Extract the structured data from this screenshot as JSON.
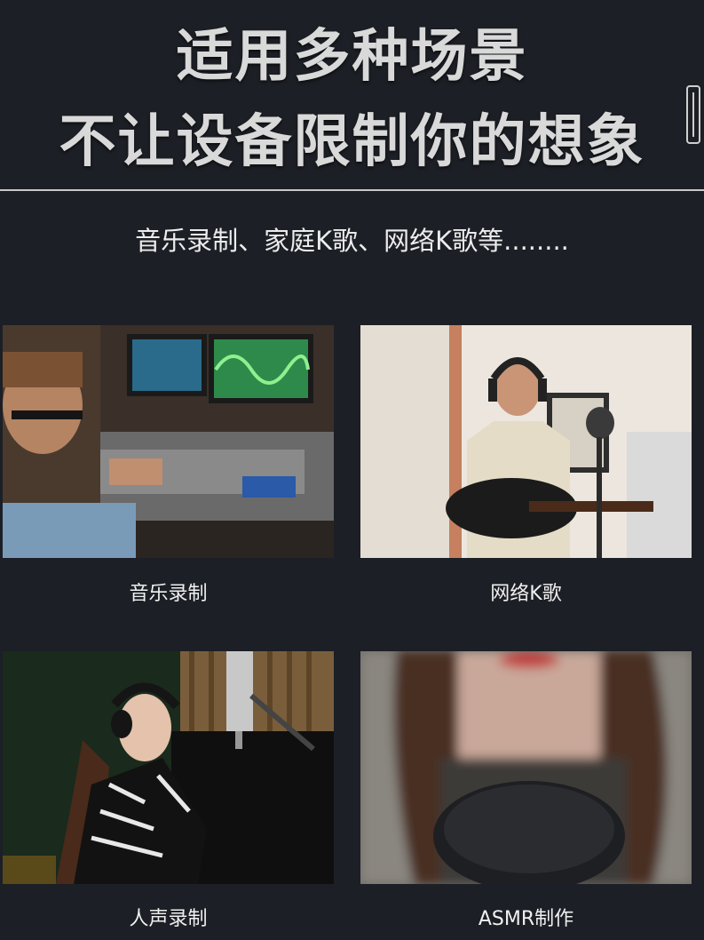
{
  "header": {
    "title_line1": "适用多种场景",
    "title_line2": "不让设备限制你的想象"
  },
  "subtitle": "音乐录制、家庭K歌、网络K歌等........",
  "scenes": [
    {
      "caption": "音乐录制"
    },
    {
      "caption": "网络K歌"
    },
    {
      "caption": "人声录制"
    },
    {
      "caption": "ASMR制作"
    }
  ]
}
